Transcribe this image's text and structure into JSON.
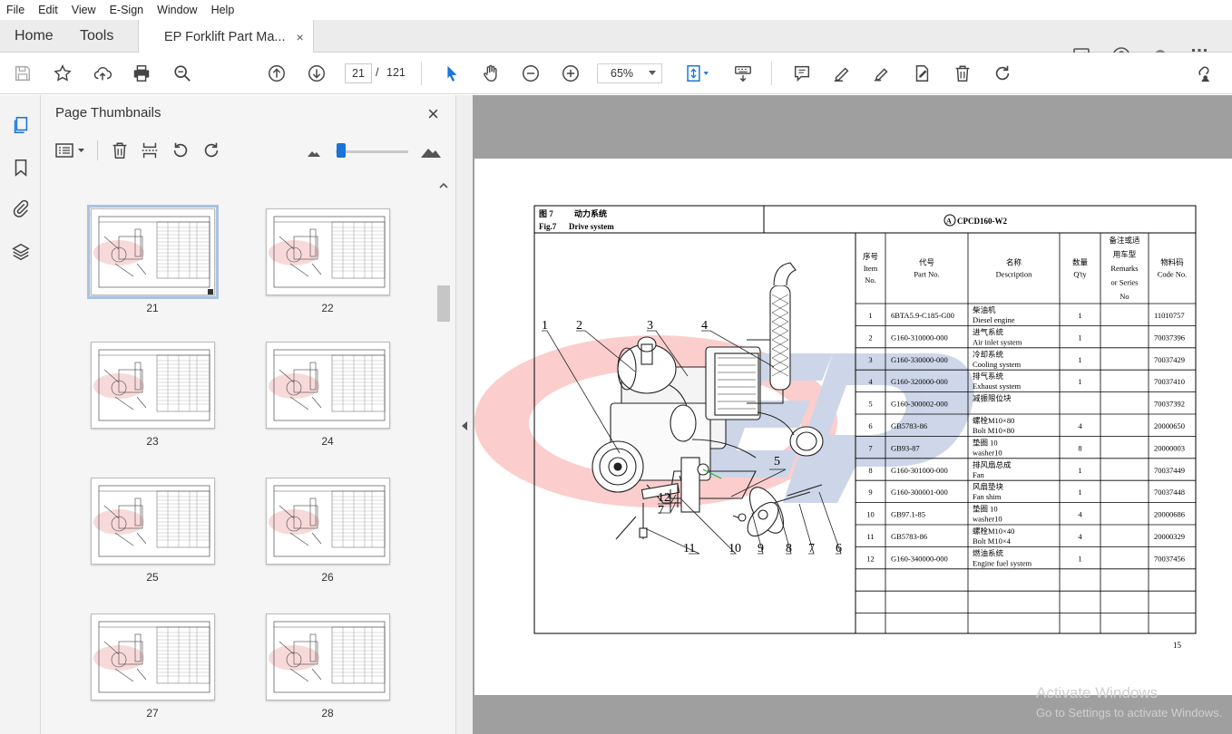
{
  "menu": [
    "File",
    "Edit",
    "View",
    "E-Sign",
    "Window",
    "Help"
  ],
  "tabs": {
    "home": "Home",
    "tools": "Tools",
    "document": "EP Forklift Part Ma...",
    "close": "×"
  },
  "toolbar": {
    "current_page": "21",
    "page_sep": "/",
    "total_pages": "121",
    "zoom": "65%"
  },
  "panel": {
    "title": "Page Thumbnails",
    "close": "×"
  },
  "thumbnails": [
    "21",
    "22",
    "23",
    "24",
    "25",
    "26",
    "27",
    "28"
  ],
  "doc": {
    "fig_cn": "图 7",
    "fig_title_cn": "动力系统",
    "fig_en": "Fig.7",
    "fig_title_en": "Drive system",
    "model": "CPCD160-W2",
    "headers": [
      [
        "序号",
        "Item",
        "No."
      ],
      [
        "代号",
        "Part No."
      ],
      [
        "名称",
        "Description"
      ],
      [
        "数量",
        "Q'ty"
      ],
      [
        "备注或适",
        "用车型",
        "Remarks",
        "or Series",
        "No"
      ],
      [
        "物料码",
        "Code No."
      ]
    ],
    "rows": [
      [
        "1",
        "6BTA5.9-C185-G00",
        "柴油机",
        "Diesel engine",
        "1",
        "",
        "11010757"
      ],
      [
        "2",
        "G160-310000-000",
        "进气系统",
        "Air inlet system",
        "1",
        "",
        "70037396"
      ],
      [
        "3",
        "G160-330000-000",
        "冷却系统",
        "Cooling system",
        "1",
        "",
        "70037429"
      ],
      [
        "4",
        "G160-320000-000",
        "排气系统",
        "Exhaust system",
        "1",
        "",
        "70037410"
      ],
      [
        "5",
        "G160-300002-000",
        "减振限位块",
        "",
        "",
        "",
        "70037392"
      ],
      [
        "6",
        "GB5783-86",
        "螺栓M10×80",
        "Bolt M10×80",
        "4",
        "",
        "20000650"
      ],
      [
        "7",
        "GB93-87",
        "垫圈 10",
        "washer10",
        "8",
        "",
        "20000003"
      ],
      [
        "8",
        "G160-301000-000",
        "排风扇总成",
        "Fan",
        "1",
        "",
        "70037449"
      ],
      [
        "9",
        "G160-300001-000",
        "风扇垫块",
        "Fan shim",
        "1",
        "",
        "70037448"
      ],
      [
        "10",
        "GB97.1-85",
        "垫圈 10",
        "washer10",
        "4",
        "",
        "20000686"
      ],
      [
        "11",
        "GB5783-86",
        "螺栓M10×40",
        "Bolt M10×4",
        "4",
        "",
        "20000329"
      ],
      [
        "12",
        "G160-340000-000",
        "燃油系统",
        "Engine fuel system",
        "1",
        "",
        "70037456"
      ]
    ],
    "callouts": [
      "1",
      "2",
      "3",
      "4",
      "5",
      "6",
      "7",
      "8",
      "9",
      "10",
      "11",
      "12",
      "7"
    ],
    "page_number": "15"
  },
  "watermark": {
    "line1": "Activate Windows",
    "line2": "Go to Settings to activate Windows."
  }
}
